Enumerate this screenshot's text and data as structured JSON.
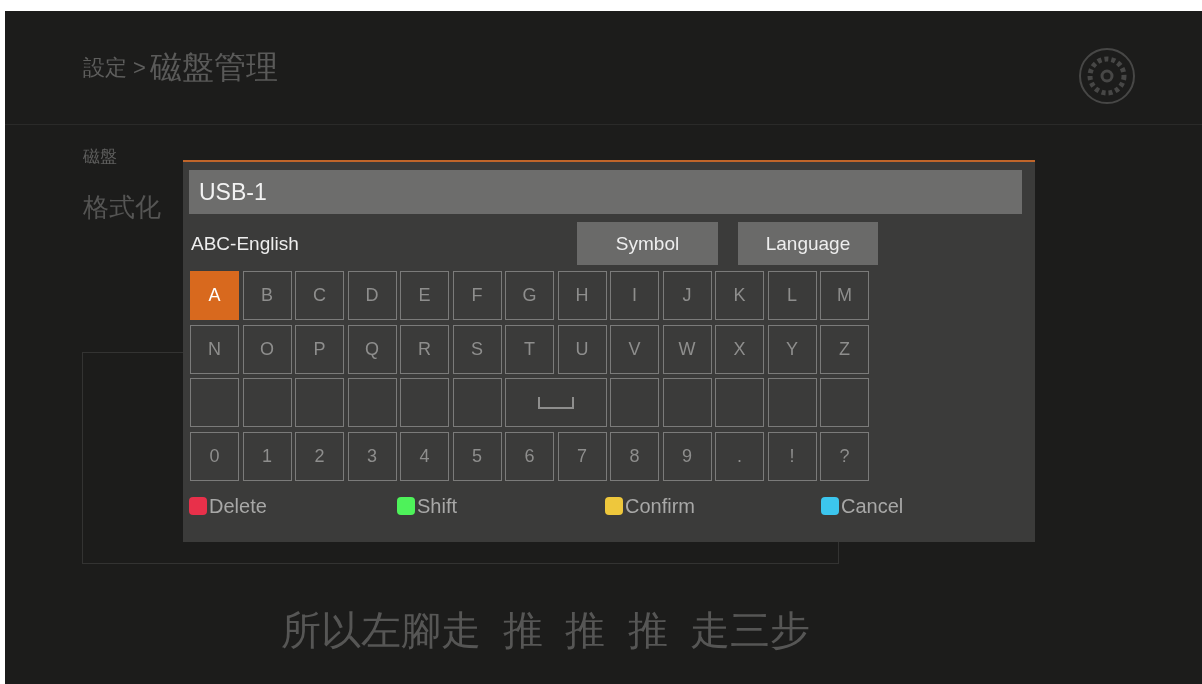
{
  "header": {
    "breadcrumb": "設定 >",
    "title": "磁盤管理"
  },
  "background_labels": [
    "磁盤",
    "格式化"
  ],
  "subtitle": "所以左腳走  推  推  推  走三步",
  "keyboard": {
    "input": {
      "value": "USB-1"
    },
    "mode": "ABC-English",
    "buttons": [
      "Symbol",
      "Language"
    ],
    "rows": [
      [
        {
          "kind": "char",
          "label": "A",
          "selected": true
        },
        {
          "kind": "char",
          "label": "B",
          "selected": false
        },
        {
          "kind": "char",
          "label": "C",
          "selected": false
        },
        {
          "kind": "char",
          "label": "D",
          "selected": false
        },
        {
          "kind": "char",
          "label": "E",
          "selected": false
        },
        {
          "kind": "char",
          "label": "F",
          "selected": false
        },
        {
          "kind": "char",
          "label": "G",
          "selected": false
        },
        {
          "kind": "char",
          "label": "H",
          "selected": false
        },
        {
          "kind": "char",
          "label": "I",
          "selected": false
        },
        {
          "kind": "char",
          "label": "J",
          "selected": false
        },
        {
          "kind": "char",
          "label": "K",
          "selected": false
        },
        {
          "kind": "char",
          "label": "L",
          "selected": false
        },
        {
          "kind": "char",
          "label": "M",
          "selected": false
        }
      ],
      [
        {
          "kind": "char",
          "label": "N",
          "selected": false
        },
        {
          "kind": "char",
          "label": "O",
          "selected": false
        },
        {
          "kind": "char",
          "label": "P",
          "selected": false
        },
        {
          "kind": "char",
          "label": "Q",
          "selected": false
        },
        {
          "kind": "char",
          "label": "R",
          "selected": false
        },
        {
          "kind": "char",
          "label": "S",
          "selected": false
        },
        {
          "kind": "char",
          "label": "T",
          "selected": false
        },
        {
          "kind": "char",
          "label": "U",
          "selected": false
        },
        {
          "kind": "char",
          "label": "V",
          "selected": false
        },
        {
          "kind": "char",
          "label": "W",
          "selected": false
        },
        {
          "kind": "char",
          "label": "X",
          "selected": false
        },
        {
          "kind": "char",
          "label": "Y",
          "selected": false
        },
        {
          "kind": "char",
          "label": "Z",
          "selected": false
        }
      ],
      [
        {
          "kind": "blank",
          "selected": false
        },
        {
          "kind": "blank",
          "selected": false
        },
        {
          "kind": "blank",
          "selected": false
        },
        {
          "kind": "blank",
          "selected": false
        },
        {
          "kind": "blank",
          "selected": false
        },
        {
          "kind": "blank",
          "selected": false
        },
        {
          "kind": "space",
          "selected": false
        },
        {
          "kind": "blank",
          "selected": false
        },
        {
          "kind": "blank",
          "selected": false
        },
        {
          "kind": "blank",
          "selected": false
        },
        {
          "kind": "blank",
          "selected": false
        },
        {
          "kind": "blank",
          "selected": false
        }
      ],
      [
        {
          "kind": "char",
          "label": "0",
          "selected": false
        },
        {
          "kind": "char",
          "label": "1",
          "selected": false
        },
        {
          "kind": "char",
          "label": "2",
          "selected": false
        },
        {
          "kind": "char",
          "label": "3",
          "selected": false
        },
        {
          "kind": "char",
          "label": "4",
          "selected": false
        },
        {
          "kind": "char",
          "label": "5",
          "selected": false
        },
        {
          "kind": "char",
          "label": "6",
          "selected": false
        },
        {
          "kind": "char",
          "label": "7",
          "selected": false
        },
        {
          "kind": "char",
          "label": "8",
          "selected": false
        },
        {
          "kind": "char",
          "label": "9",
          "selected": false
        },
        {
          "kind": "char",
          "label": ".",
          "selected": false
        },
        {
          "kind": "char",
          "label": "!",
          "selected": false
        },
        {
          "kind": "char",
          "label": "?",
          "selected": false
        }
      ]
    ],
    "legend": [
      {
        "label": "Delete",
        "color": "#e8304a"
      },
      {
        "label": "Shift",
        "color": "#4ef25a"
      },
      {
        "label": "Confirm",
        "color": "#eec73c"
      },
      {
        "label": "Cancel",
        "color": "#3cc6ee"
      }
    ]
  }
}
